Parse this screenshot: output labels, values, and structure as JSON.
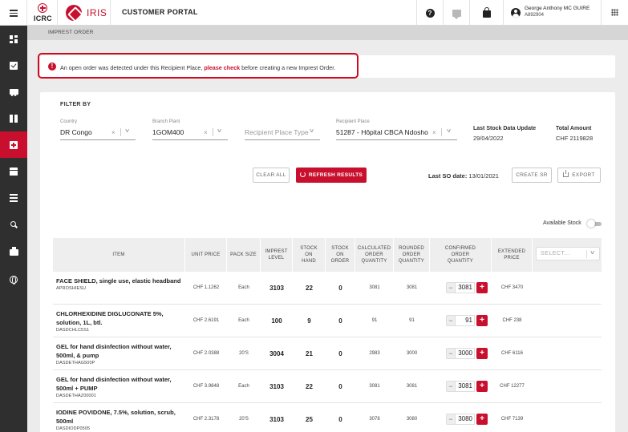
{
  "header": {
    "icrc_logo_text": "ICRC",
    "iris_logo_text": "IRIS",
    "portal_title": "CUSTOMER PORTAL",
    "help_glyph": "?",
    "user_name": "George Anthony MC GUIRE",
    "user_id": "A892904",
    "icons": [
      "menu-icon",
      "help-icon",
      "chat-icon",
      "shopping-bag-icon",
      "user-icon",
      "apps-grid-icon"
    ]
  },
  "sidebar": {
    "items": [
      {
        "icon": "dashboard-icon",
        "active": false
      },
      {
        "icon": "checklist-icon",
        "active": false
      },
      {
        "icon": "truck-icon",
        "active": false
      },
      {
        "icon": "gift-icon",
        "active": false
      },
      {
        "icon": "medical-plus-icon",
        "active": true
      },
      {
        "icon": "store-icon",
        "active": false
      },
      {
        "icon": "list-icon",
        "active": false
      },
      {
        "icon": "search-icon",
        "active": false
      },
      {
        "icon": "print-icon",
        "active": false
      },
      {
        "icon": "globe-icon",
        "active": false
      }
    ]
  },
  "breadcrumb": "IMPREST ORDER",
  "alert": {
    "glyph": "!",
    "text_before": "An open order was detected under this Recipient Place, ",
    "link": "please check",
    "text_after": " before creating a new Imprest Order."
  },
  "filter": {
    "title": "FILTER BY",
    "country_label": "Country",
    "country_value": "DR Congo",
    "branch_label": "Branch Plant",
    "branch_value": "1GOM400",
    "recipient_type_placeholder": "Recipient Place Type",
    "recipient_label": "Recipient Place",
    "recipient_value": "51287 - Hôpital CBCA Ndosho",
    "clear_glyph": "×",
    "chevron_glyph": "∨",
    "last_stock_label": "Last Stock Data Update",
    "last_stock_value": "29/04/2022",
    "total_amount_label": "Total Amount",
    "total_amount_value": "CHF 2119828",
    "clear_all": "CLEAR ALL",
    "refresh": "REFRESH RESULTS",
    "last_so_label": "Last SO date:",
    "last_so_value": " 13/01/2021",
    "create_sr": "CREATE SR",
    "export": "EXPORT"
  },
  "results": {
    "available_stock_label": "Available Stock",
    "available_stock_on": false,
    "columns": [
      "ITEM",
      "UNIT PRICE",
      "PACK SIZE",
      "IMPREST LEVEL",
      "STOCK ON HAND",
      "STOCK ON ORDER",
      "CALCULATED ORDER QUANTITY",
      "ROUNDED ORDER QUANTITY",
      "CONFIRMED ORDER QUANTITY",
      "EXTENDED PRICE"
    ],
    "select_placeholder": "SELECT...",
    "minus_glyph": "−",
    "plus_glyph": "+",
    "rows": [
      {
        "name": "FACE SHIELD, single use, elastic headband",
        "code": "APROSHIESU",
        "unit_price": "CHF 1.1262",
        "pack_size": "Each",
        "imprest_level": "3103",
        "stock_on_hand": "22",
        "stock_on_order": "0",
        "calculated": "3081",
        "rounded": "3081",
        "confirmed": "3081",
        "extended": "CHF 3470"
      },
      {
        "name": "CHLORHEXIDINE DIGLUCONATE 5%, solution, 1L, btl.",
        "code": "DASDCHLC5S1",
        "unit_price": "CHF 2.6191",
        "pack_size": "Each",
        "imprest_level": "100",
        "stock_on_hand": "9",
        "stock_on_order": "0",
        "calculated": "91",
        "rounded": "91",
        "confirmed": "91",
        "extended": "CHF 238"
      },
      {
        "name": "GEL for hand disinfection without water, 500ml, & pump",
        "code": "DASDETHAG500P",
        "unit_price": "CHF 2.0388",
        "pack_size": "20'S",
        "imprest_level": "3004",
        "stock_on_hand": "21",
        "stock_on_order": "0",
        "calculated": "2983",
        "rounded": "3000",
        "confirmed": "3000",
        "extended": "CHF 6116"
      },
      {
        "name": "GEL for hand disinfection without water, 500ml + PUMP",
        "code": "DASDETHAZ00001",
        "unit_price": "CHF 3.9848",
        "pack_size": "Each",
        "imprest_level": "3103",
        "stock_on_hand": "22",
        "stock_on_order": "0",
        "calculated": "3081",
        "rounded": "3081",
        "confirmed": "3081",
        "extended": "CHF 12277"
      },
      {
        "name": "IODINE POVIDONE, 7.5%, solution, scrub, 500ml",
        "code": "DASDIODP0505",
        "unit_price": "CHF 2.3178",
        "pack_size": "20'S",
        "imprest_level": "3103",
        "stock_on_hand": "25",
        "stock_on_order": "0",
        "calculated": "3078",
        "rounded": "3080",
        "confirmed": "3080",
        "extended": "CHF 7139"
      }
    ]
  }
}
